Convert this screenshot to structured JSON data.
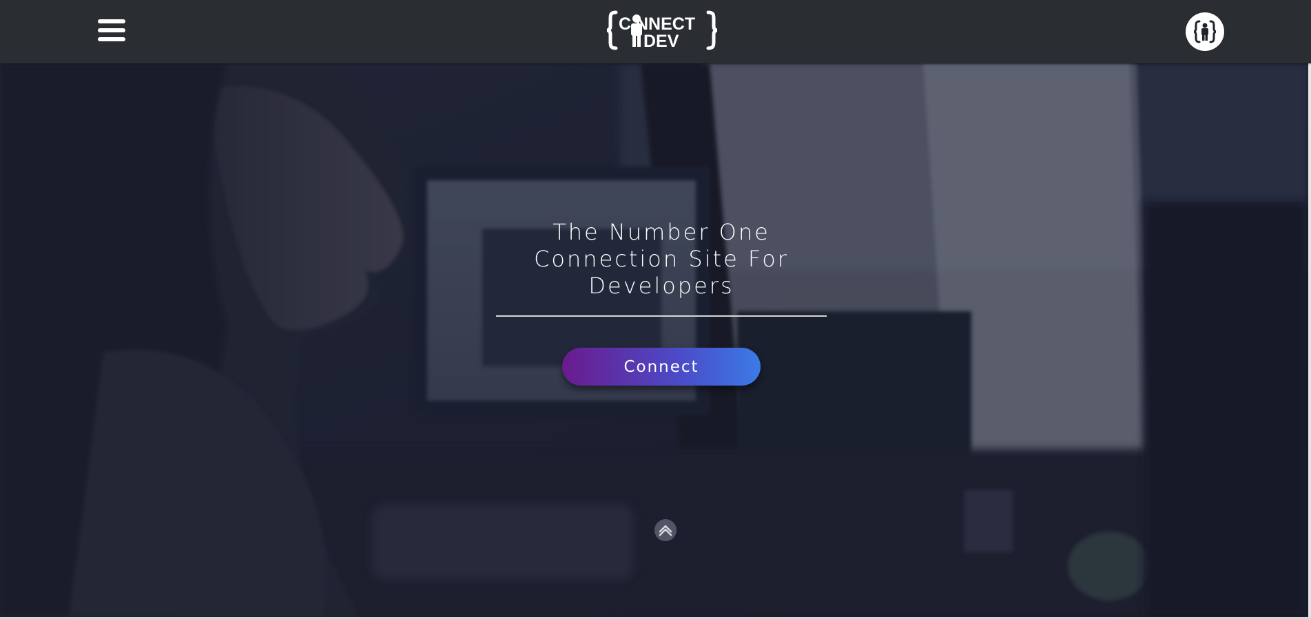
{
  "header": {
    "menu_icon": "hamburger-menu-icon",
    "logo_text_top": "C  NNECT",
    "logo_text_bottom": "DEV",
    "logo_icon": "person-icon",
    "profile_icon": "braces-person-icon"
  },
  "hero": {
    "title": "The Number One\nConnection Site For\nDevelopers",
    "connect_label": "Connect",
    "scroll_icon": "chevron-up-icon"
  },
  "colors": {
    "nav_background": "#2a2e33",
    "button_gradient_start": "#6a1b8e",
    "button_gradient_end": "#3b7be6",
    "text": "#ffffff"
  }
}
